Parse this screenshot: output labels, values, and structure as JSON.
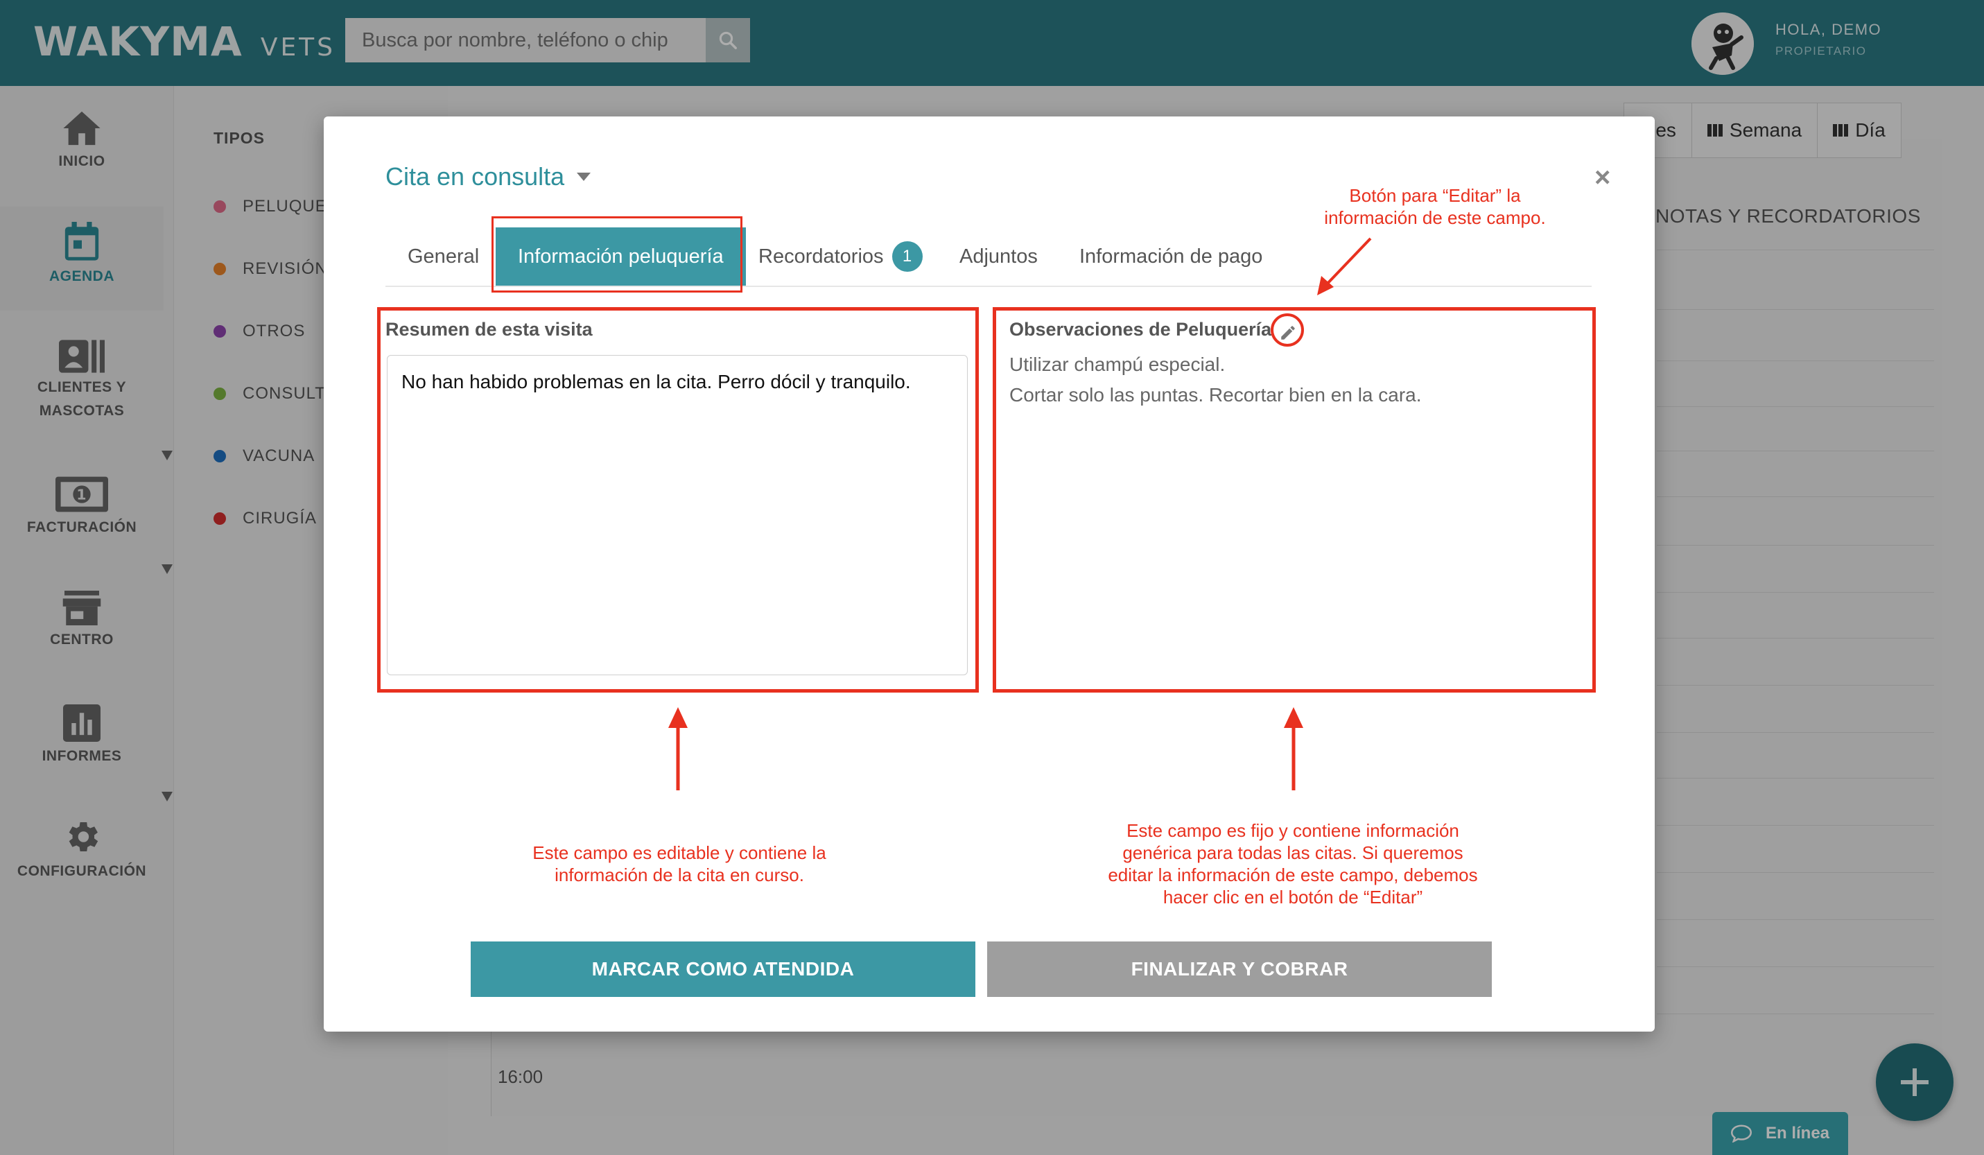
{
  "header": {
    "logo_main": "WAKYMA",
    "logo_sub": "VETS",
    "search_placeholder": "Busca por nombre, teléfono o chip",
    "greeting": "HOLA, DEMO",
    "role": "PROPIETARIO"
  },
  "sidebar": {
    "items": [
      {
        "label": "INICIO",
        "icon": "home-icon"
      },
      {
        "label": "AGENDA",
        "icon": "calendar-icon"
      },
      {
        "label": "CLIENTES Y MASCOTAS",
        "icon": "contacts-icon"
      },
      {
        "label": "FACTURACIÓN",
        "icon": "money-icon"
      },
      {
        "label": "CENTRO",
        "icon": "store-icon"
      },
      {
        "label": "INFORMES",
        "icon": "chart-icon"
      },
      {
        "label": "CONFIGURACIÓN",
        "icon": "gear-icon"
      }
    ]
  },
  "tipos": {
    "title": "TIPOS",
    "items": [
      {
        "label": "PELUQUER",
        "color": "#e06b8a"
      },
      {
        "label": "REVISIÓN",
        "color": "#e8822a"
      },
      {
        "label": "OTROS",
        "color": "#8e44ad"
      },
      {
        "label": "CONSULTA",
        "color": "#7cb342"
      },
      {
        "label": "VACUNA",
        "color": "#1e6fc0"
      },
      {
        "label": "CIRUGÍA",
        "color": "#d32f2f"
      }
    ]
  },
  "calendar": {
    "views": [
      "Mes",
      "Semana",
      "Día"
    ],
    "notes_title": "NOTAS Y RECORDATORIOS",
    "time_label": "16:00",
    "online_label": "En línea"
  },
  "modal": {
    "title": "Cita en consulta",
    "tabs": [
      {
        "label": "General"
      },
      {
        "label": "Información peluquería"
      },
      {
        "label": "Recordatorios",
        "badge": "1"
      },
      {
        "label": "Adjuntos"
      },
      {
        "label": "Información de pago"
      }
    ],
    "summary_label": "Resumen de esta visita",
    "summary_value": "No han habido problemas en la cita. Perro dócil y tranquilo.",
    "obs_label": "Observaciones de Peluquería",
    "obs_lines": [
      "Utilizar champú especial.",
      "Cortar solo las puntas. Recortar bien en la cara."
    ],
    "btn_attended": "MARCAR COMO ATENDIDA",
    "btn_finish": "FINALIZAR Y COBRAR"
  },
  "annotations": {
    "edit_note_l1": "Botón para “Editar” la",
    "edit_note_l2": "información de este campo.",
    "left_note_l1": "Este campo es editable y contiene la",
    "left_note_l2": "información de la cita en curso.",
    "right_note_l1": "Este campo es fijo y contiene información",
    "right_note_l2": "genérica para todas las citas. Si queremos",
    "right_note_l3": "editar la información de este campo, debemos",
    "right_note_l4": "hacer clic en el botón de “Editar”"
  },
  "colors": {
    "brand": "#2b7a84",
    "accent": "#3c98a4",
    "annotation": "#e8311f"
  }
}
